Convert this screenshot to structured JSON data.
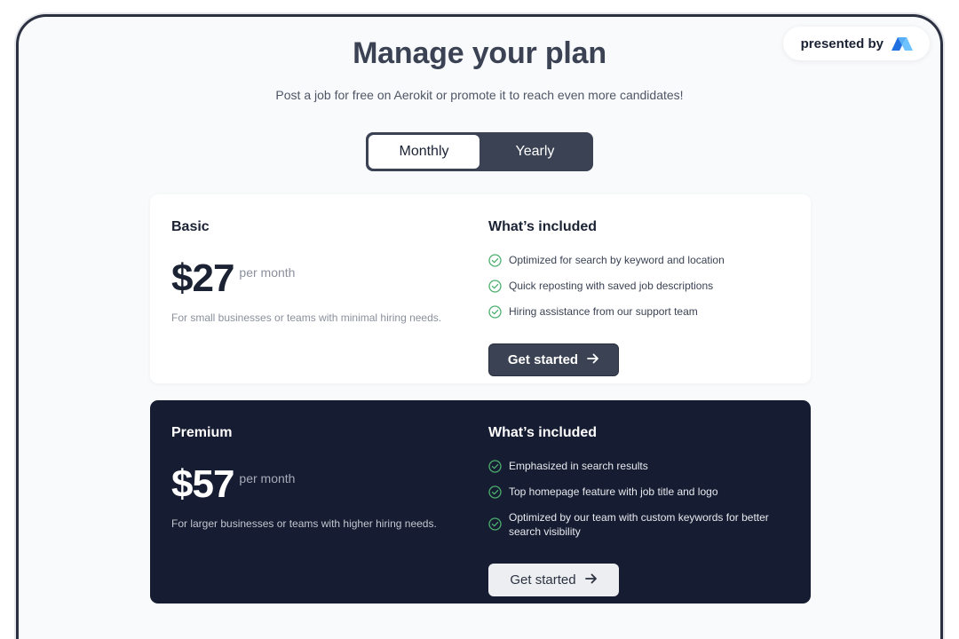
{
  "badge": {
    "label": "presented by",
    "logo_icon": "brand-m-logo"
  },
  "header": {
    "title": "Manage your plan",
    "subtitle": "Post a job for free on Aerokit or promote it to reach even more candidates!"
  },
  "billing_toggle": {
    "options": [
      "Monthly",
      "Yearly"
    ],
    "selected": "Monthly"
  },
  "plans": [
    {
      "name": "Basic",
      "price": "$27",
      "period": "per month",
      "description": "For small businesses or teams with minimal hiring needs.",
      "included_title": "What’s included",
      "features": [
        "Optimized for search by keyword and location",
        "Quick reposting with saved job descriptions",
        "Hiring assistance from our support team"
      ],
      "cta": "Get started"
    },
    {
      "name": "Premium",
      "price": "$57",
      "period": "per month",
      "description": "For larger businesses or teams with higher hiring needs.",
      "included_title": "What’s included",
      "features": [
        "Emphasized in search results",
        "Top homepage feature with job title and logo",
        "Optimized by our team with custom keywords for better search visibility"
      ],
      "cta": "Get started"
    }
  ],
  "colors": {
    "accent_dark": "#3a4253",
    "premium_bg": "#161c31",
    "check_green": "#4caf6e"
  }
}
